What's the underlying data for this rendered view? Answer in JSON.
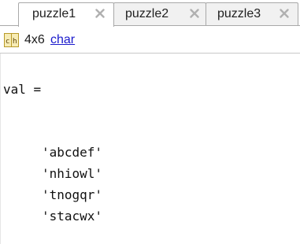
{
  "tabs": [
    {
      "label": "puzzle1",
      "active": true
    },
    {
      "label": "puzzle2",
      "active": false
    },
    {
      "label": "puzzle3",
      "active": false
    }
  ],
  "info": {
    "icon": "char-array-icon",
    "dimensions": "4x6",
    "class_name": "char"
  },
  "output": {
    "variable_line": "val =",
    "rows": [
      "'abcdef'",
      "'nhiowl'",
      "'tnogqr'",
      "'stacwx'"
    ]
  },
  "colors": {
    "link": "#1a1acc",
    "tab_border": "#a9a9a9",
    "tab_inactive_bg": "#f1f1f1",
    "close_icon": "#b0b0b0"
  }
}
